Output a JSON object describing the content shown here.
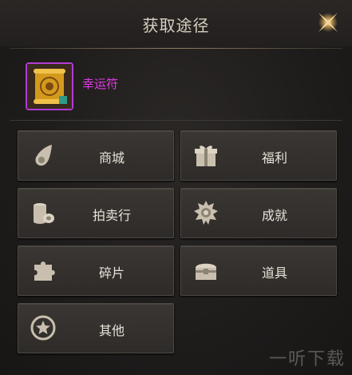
{
  "header": {
    "title": "获取途径"
  },
  "item": {
    "name": "幸运符",
    "rarity_color": "#e23ae8"
  },
  "buttons": [
    {
      "label": "商城",
      "icon": "meteor-icon"
    },
    {
      "label": "福利",
      "icon": "gift-icon"
    },
    {
      "label": "拍卖行",
      "icon": "coins-icon"
    },
    {
      "label": "成就",
      "icon": "medal-icon"
    },
    {
      "label": "碎片",
      "icon": "puzzle-icon"
    },
    {
      "label": "道具",
      "icon": "chest-icon"
    },
    {
      "label": "其他",
      "icon": "star-circle-icon"
    }
  ],
  "watermark": {
    "text": "一听下载"
  },
  "colors": {
    "panel_bg": "#1d1b1a",
    "title": "#d9cfc0",
    "button_text": "#e8e2d8",
    "item_frame": "#b23bd6"
  }
}
